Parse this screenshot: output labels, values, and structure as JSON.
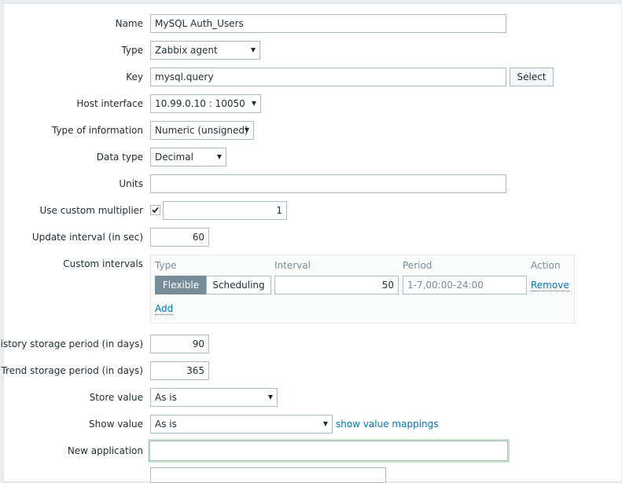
{
  "form": {
    "name": {
      "label": "Name",
      "value": "MySQL Auth_Users"
    },
    "type": {
      "label": "Type",
      "value": "Zabbix agent"
    },
    "key": {
      "label": "Key",
      "value": "mysql.query",
      "select_label": "Select"
    },
    "host_interface": {
      "label": "Host interface",
      "value": "10.99.0.10 : 10050"
    },
    "type_of_information": {
      "label": "Type of information",
      "value": "Numeric (unsigned)"
    },
    "data_type": {
      "label": "Data type",
      "value": "Decimal"
    },
    "units": {
      "label": "Units",
      "value": ""
    },
    "custom_multiplier": {
      "label": "Use custom multiplier",
      "checked": true,
      "value": "1"
    },
    "update_interval": {
      "label": "Update interval (in sec)",
      "value": "60"
    },
    "custom_intervals": {
      "label": "Custom intervals",
      "headers": {
        "type": "Type",
        "interval": "Interval",
        "period": "Period",
        "action": "Action"
      },
      "rows": [
        {
          "type_options": [
            "Flexible",
            "Scheduling"
          ],
          "type_selected": "Flexible",
          "interval": "50",
          "period": "1-7,00:00-24:00",
          "action": "Remove"
        }
      ],
      "add_label": "Add"
    },
    "history": {
      "label": "History storage period (in days)",
      "value": "90"
    },
    "trend": {
      "label": "Trend storage period (in days)",
      "value": "365"
    },
    "store_value": {
      "label": "Store value",
      "value": "As is"
    },
    "show_value": {
      "label": "Show value",
      "value": "As is",
      "mappings_link": "show value mappings"
    },
    "new_application": {
      "label": "New application",
      "value": ""
    }
  },
  "colors": {
    "link": "#0275b8",
    "active_segment": "#768d99",
    "focus_border": "#c8e2c9",
    "border": "#acbbc2"
  }
}
